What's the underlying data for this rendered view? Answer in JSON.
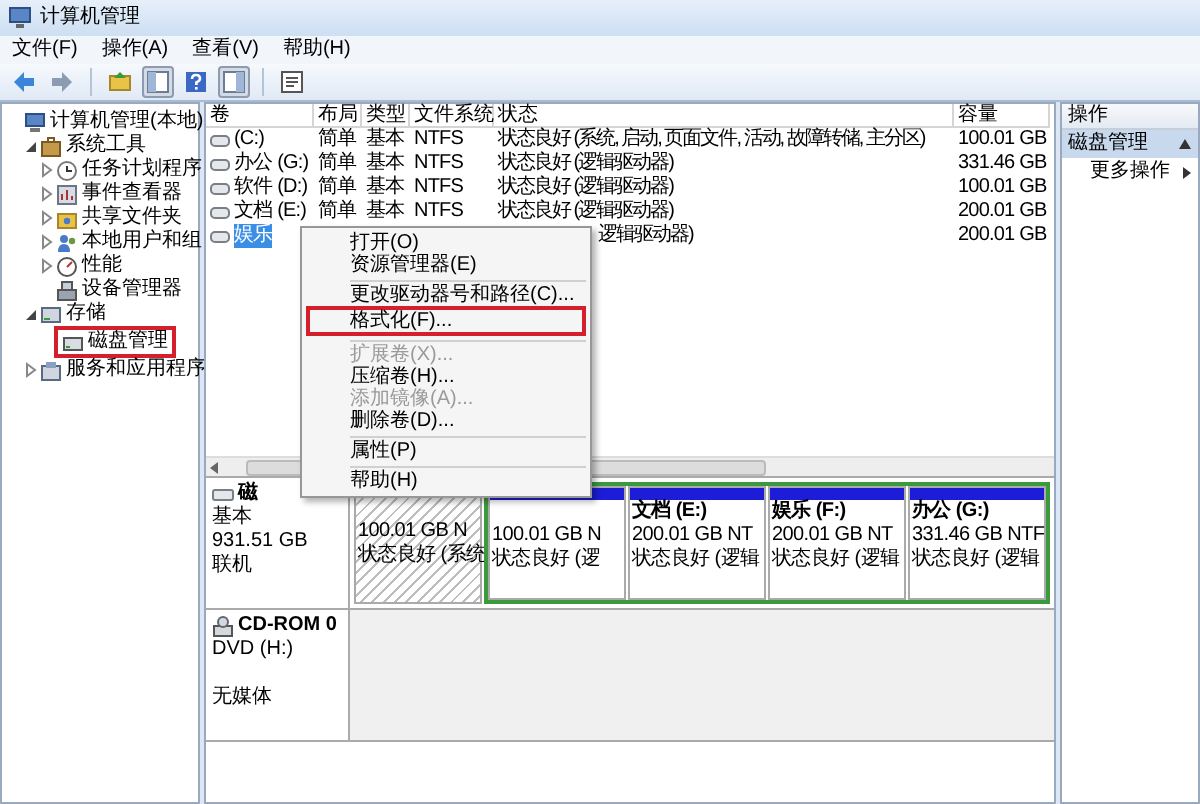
{
  "window": {
    "title": "计算机管理"
  },
  "menu_bar": [
    "文件(F)",
    "操作(A)",
    "查看(V)",
    "帮助(H)"
  ],
  "toolbar": [
    {
      "kind": "back",
      "pressed": false
    },
    {
      "kind": "forward",
      "pressed": false
    },
    {
      "kind": "up",
      "pressed": false
    },
    {
      "kind": "tree",
      "pressed": true
    },
    {
      "kind": "help",
      "pressed": false
    },
    {
      "kind": "pane",
      "pressed": true
    },
    {
      "kind": "export",
      "pressed": false
    }
  ],
  "tree": [
    {
      "label": "计算机管理(本地)",
      "highlighted": false,
      "children": [
        {
          "label": "系统工具",
          "expanded": true,
          "highlighted": false,
          "children": [
            {
              "label": "任务计划程序",
              "expanded": false,
              "highlighted": false
            },
            {
              "label": "事件查看器",
              "expanded": false,
              "highlighted": false
            },
            {
              "label": "共享文件夹",
              "expanded": false,
              "highlighted": false
            },
            {
              "label": "本地用户和组",
              "expanded": false,
              "highlighted": false
            },
            {
              "label": "性能",
              "expanded": false,
              "highlighted": false
            },
            {
              "label": "设备管理器",
              "highlighted": false
            }
          ]
        },
        {
          "label": "存储",
          "expanded": true,
          "highlighted": false,
          "children": [
            {
              "label": "磁盘管理",
              "highlighted": true
            }
          ]
        },
        {
          "label": "服务和应用程序",
          "expanded": false,
          "highlighted": false
        }
      ]
    }
  ],
  "table": {
    "columns": [
      "卷",
      "布局",
      "类型",
      "文件系统",
      "状态",
      "容量"
    ],
    "rows": [
      {
        "volume": "(C:)",
        "layout": "简单",
        "type": "基本",
        "file_system": "NTFS",
        "status": "状态良好 (系统, 启动, 页面文件, 活动, 故障转储, 主分区)",
        "capacity": "100.01 GB",
        "selected": false
      },
      {
        "volume": "办公 (G:)",
        "layout": "简单",
        "type": "基本",
        "file_system": "NTFS",
        "status": "状态良好 (逻辑驱动器)",
        "capacity": "331.46 GB",
        "selected": false
      },
      {
        "volume": "软件 (D:)",
        "layout": "简单",
        "type": "基本",
        "file_system": "NTFS",
        "status": "状态良好 (逻辑驱动器)",
        "capacity": "100.01 GB",
        "selected": false
      },
      {
        "volume": "文档 (E:)",
        "layout": "简单",
        "type": "基本",
        "file_system": "NTFS",
        "status": "状态良好 (逻辑驱动器)",
        "capacity": "200.01 GB",
        "selected": false
      },
      {
        "volume": "娱乐",
        "status": "逻辑驱动器)",
        "capacity": "200.01 GB",
        "selected": true
      }
    ]
  },
  "disks": [
    {
      "kind": "disk",
      "name": "磁",
      "type": "基本",
      "size": "931.51 GB",
      "state": "联机",
      "partitions": [
        {
          "kind": "primary",
          "size": "100.01 GB N",
          "status": "状态良好 (系统",
          "selected": true
        },
        {
          "kind": "logical",
          "size": "100.01 GB N",
          "status": "状态良好 (逻",
          "selected": false
        },
        {
          "kind": "logical",
          "label": "文档  (E:)",
          "size": "200.01 GB NT",
          "status": "状态良好 (逻辑",
          "selected": false
        },
        {
          "kind": "logical",
          "label": "娱乐  (F:)",
          "size": "200.01 GB NT",
          "status": "状态良好 (逻辑",
          "selected": false
        },
        {
          "kind": "logical",
          "label": "办公  (G:)",
          "size": "331.46 GB NTF",
          "status": "状态良好 (逻辑",
          "selected": false
        }
      ]
    },
    {
      "kind": "cdrom",
      "name": "CD-ROM 0",
      "type": "DVD (H:)",
      "state": "无媒体"
    }
  ],
  "context_menu": [
    {
      "kind": "item",
      "label": "打开(O)",
      "disabled": false,
      "highlighted": false
    },
    {
      "kind": "item",
      "label": "资源管理器(E)",
      "disabled": false,
      "highlighted": false
    },
    {
      "kind": "separator"
    },
    {
      "kind": "item",
      "label": "更改驱动器号和路径(C)...",
      "disabled": false,
      "highlighted": false
    },
    {
      "kind": "item",
      "label": "格式化(F)...",
      "disabled": false,
      "highlighted": true
    },
    {
      "kind": "separator"
    },
    {
      "kind": "item",
      "label": "扩展卷(X)...",
      "disabled": true,
      "highlighted": false
    },
    {
      "kind": "item",
      "label": "压缩卷(H)...",
      "disabled": false,
      "highlighted": false
    },
    {
      "kind": "item",
      "label": "添加镜像(A)...",
      "disabled": true,
      "highlighted": false
    },
    {
      "kind": "item",
      "label": "删除卷(D)...",
      "disabled": false,
      "highlighted": false
    },
    {
      "kind": "separator"
    },
    {
      "kind": "item",
      "label": "属性(P)",
      "disabled": false,
      "highlighted": false
    },
    {
      "kind": "separator"
    },
    {
      "kind": "item",
      "label": "帮助(H)",
      "disabled": false,
      "highlighted": false
    }
  ],
  "actions": {
    "header": "操作",
    "section": "磁盘管理",
    "items": [
      "更多操作"
    ]
  }
}
